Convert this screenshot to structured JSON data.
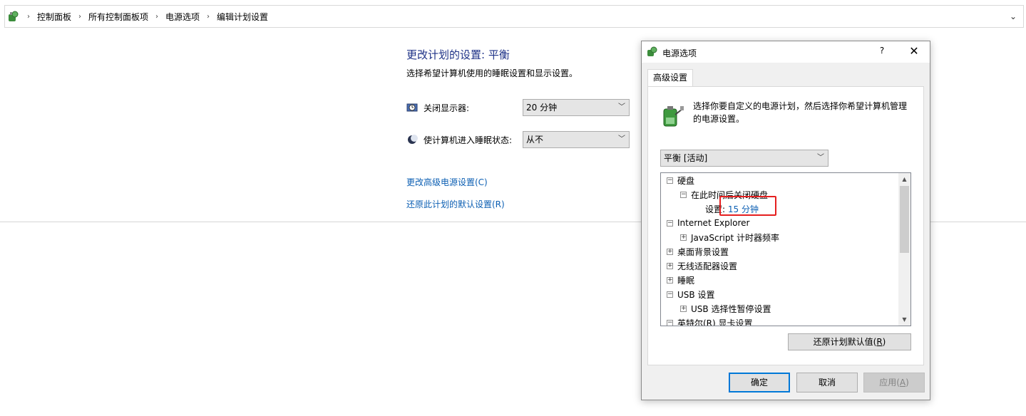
{
  "address_bar": {
    "crumbs": [
      "控制面板",
      "所有控制面板项",
      "电源选项",
      "编辑计划设置"
    ]
  },
  "main": {
    "title": "更改计划的设置: 平衡",
    "subtitle": "选择希望计算机使用的睡眠设置和显示设置。",
    "display_off": {
      "label": "关闭显示器:",
      "value": "20 分钟"
    },
    "sleep": {
      "label": "使计算机进入睡眠状态:",
      "value": "从不"
    },
    "links": {
      "advanced": "更改高级电源设置(C)",
      "restore": "还原此计划的默认设置(R)"
    }
  },
  "dialog": {
    "title": "电源选项",
    "help": "?",
    "close": "✕",
    "tab": "高级设置",
    "description": "选择你要自定义的电源计划，然后选择你希望计算机管理的电源设置。",
    "plan_select": "平衡 [活动]",
    "tree": [
      {
        "toggle": "⊟",
        "label": "硬盘"
      },
      {
        "toggle": "⊟",
        "label": "在此时间后关闭硬盘"
      },
      {
        "label": "设置:",
        "value": "15 分钟"
      },
      {
        "toggle": "⊟",
        "label": "Internet Explorer"
      },
      {
        "toggle": "⊞",
        "label": "JavaScript 计时器频率"
      },
      {
        "toggle": "⊞",
        "label": "桌面背景设置"
      },
      {
        "toggle": "⊞",
        "label": "无线适配器设置"
      },
      {
        "toggle": "⊞",
        "label": "睡眠"
      },
      {
        "toggle": "⊟",
        "label": "USB 设置"
      },
      {
        "toggle": "⊞",
        "label": "USB 选择性暂停设置"
      },
      {
        "toggle": "⊟",
        "label": "英特尔(R) 显卡设置"
      }
    ],
    "restore_btn": {
      "text": "还原计划默认值(",
      "key": "R",
      "end": ")"
    },
    "ok_btn": "确定",
    "cancel_btn": "取消",
    "apply_btn": {
      "text": "应用(",
      "key": "A",
      "end": ")"
    }
  }
}
